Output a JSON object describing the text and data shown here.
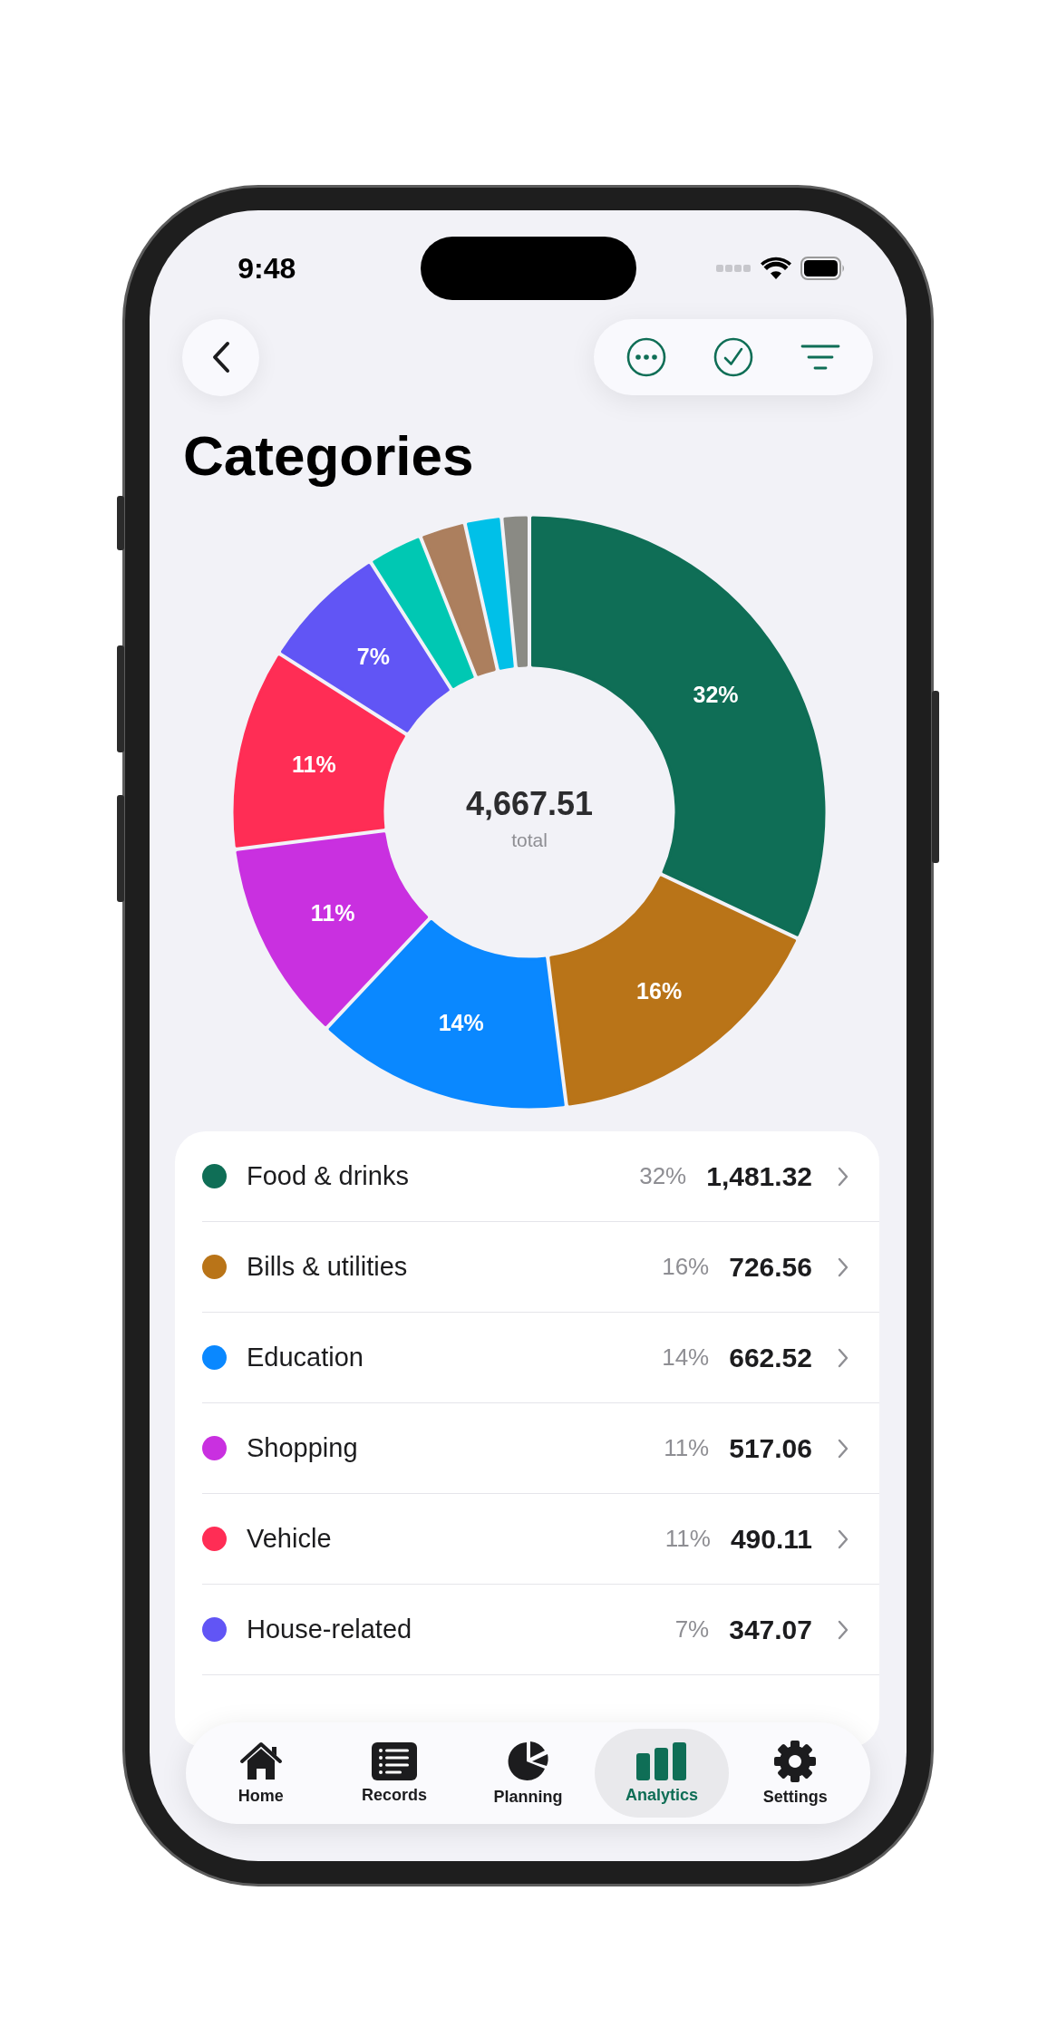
{
  "status_bar": {
    "time": "9:48"
  },
  "title": "Categories",
  "chart": {
    "chart_data": {
      "type": "donut",
      "values": [
        32,
        16,
        14,
        11,
        11,
        7,
        3,
        2.5,
        2,
        1.5
      ],
      "colors": [
        "#0f6e56",
        "#b97418",
        "#0a88ff",
        "#c930e0",
        "#ff2d55",
        "#6155f5",
        "#00c8b3",
        "#ac7f5e",
        "#00c0e8",
        "#8a8a84"
      ],
      "value_labels": [
        "32%",
        "16%",
        "14%",
        "11%",
        "11%",
        "7%",
        null,
        null,
        null,
        null
      ]
    },
    "total": "4,667.51",
    "total_label": "total"
  },
  "categories": [
    {
      "name": "Food & drinks",
      "percent": "32%",
      "amount": "1,481.32",
      "color": "#0f6e56"
    },
    {
      "name": "Bills & utilities",
      "percent": "16%",
      "amount": "726.56",
      "color": "#b97418"
    },
    {
      "name": "Education",
      "percent": "14%",
      "amount": "662.52",
      "color": "#0a88ff"
    },
    {
      "name": "Shopping",
      "percent": "11%",
      "amount": "517.06",
      "color": "#c930e0"
    },
    {
      "name": "Vehicle",
      "percent": "11%",
      "amount": "490.11",
      "color": "#ff2d55"
    },
    {
      "name": "House-related",
      "percent": "7%",
      "amount": "347.07",
      "color": "#6155f5"
    }
  ],
  "tab_bar": [
    {
      "kind": "home",
      "label": "Home",
      "selected": false
    },
    {
      "kind": "records",
      "label": "Records",
      "selected": false
    },
    {
      "kind": "planning",
      "label": "Planning",
      "selected": false
    },
    {
      "kind": "analytics",
      "label": "Analytics",
      "selected": true
    },
    {
      "kind": "settings",
      "label": "Settings",
      "selected": false
    }
  ]
}
